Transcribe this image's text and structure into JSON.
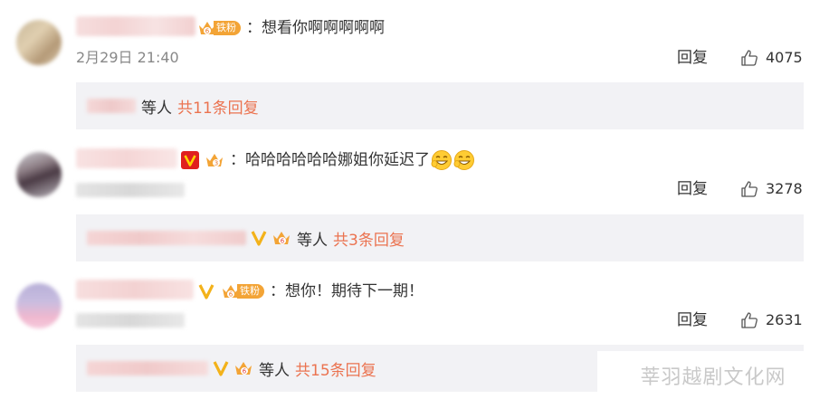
{
  "colors": {
    "accent_orange": "#eb7350",
    "reply_bg": "#f2f2f5",
    "meta_grey": "#888888"
  },
  "comments": [
    {
      "badges": [
        "fan-level-6-badge"
      ],
      "fan_badge_text": "铁粉",
      "text": "：想看你啊啊啊啊啊",
      "date": "2月29日 21:40",
      "reply_label": "回复",
      "likes": "4075",
      "sub": {
        "etc": "等人",
        "total": "共11条回复"
      }
    },
    {
      "badges": [
        "verified-v-badge",
        "fan-level-3-badge"
      ],
      "text": "：哈哈哈哈哈哈娜姐你延迟了",
      "emojis": [
        "grin-emoji",
        "grin-emoji"
      ],
      "reply_label": "回复",
      "likes": "3278",
      "sub": {
        "etc": "等人",
        "total": "共3条回复"
      }
    },
    {
      "badges": [
        "verified-v-badge",
        "fan-level-6-badge"
      ],
      "fan_badge_text": "铁粉",
      "text": "：想你！期待下一期！",
      "reply_label": "回复",
      "likes": "2631",
      "sub": {
        "etc": "等人",
        "total": "共15条回复"
      }
    }
  ],
  "watermark": "莘羽越剧文化网"
}
